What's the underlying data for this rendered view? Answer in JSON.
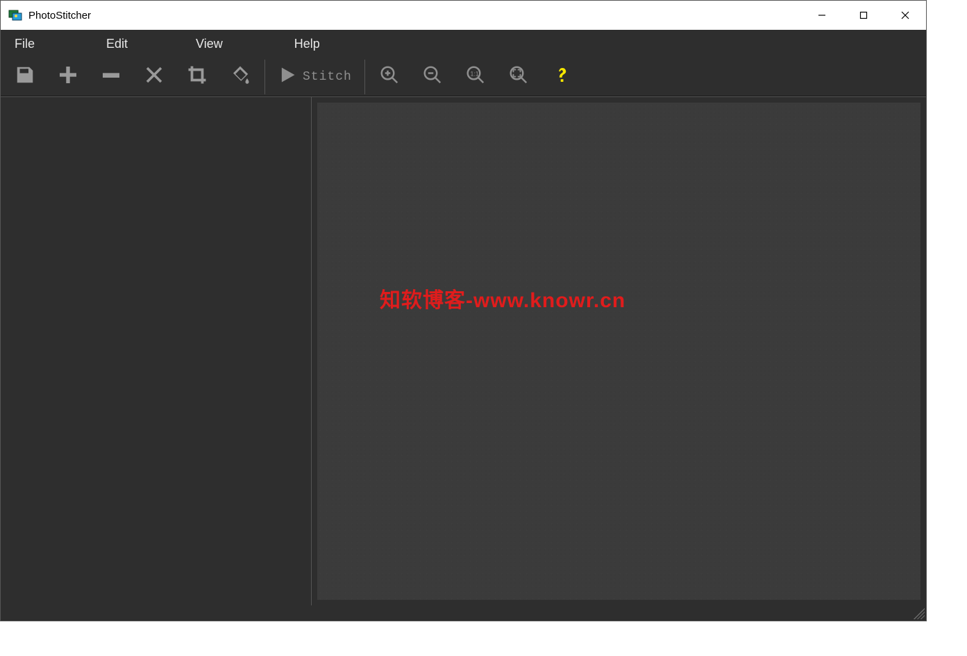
{
  "window": {
    "title": "PhotoStitcher"
  },
  "menu": {
    "items": [
      "File",
      "Edit",
      "View",
      "Help"
    ]
  },
  "toolbar": {
    "save_icon": "save",
    "add_icon": "plus",
    "remove_icon": "minus",
    "clear_icon": "x",
    "crop_icon": "crop",
    "fill_icon": "paint-bucket",
    "stitch_icon": "play",
    "stitch_label": "Stitch",
    "zoom_in_icon": "zoom-in",
    "zoom_out_icon": "zoom-out",
    "zoom_11_icon": "zoom-1-1",
    "zoom_fit_icon": "zoom-fit",
    "help_icon": "question"
  },
  "canvas": {
    "watermark": "知软博客-www.knowr.cn"
  }
}
